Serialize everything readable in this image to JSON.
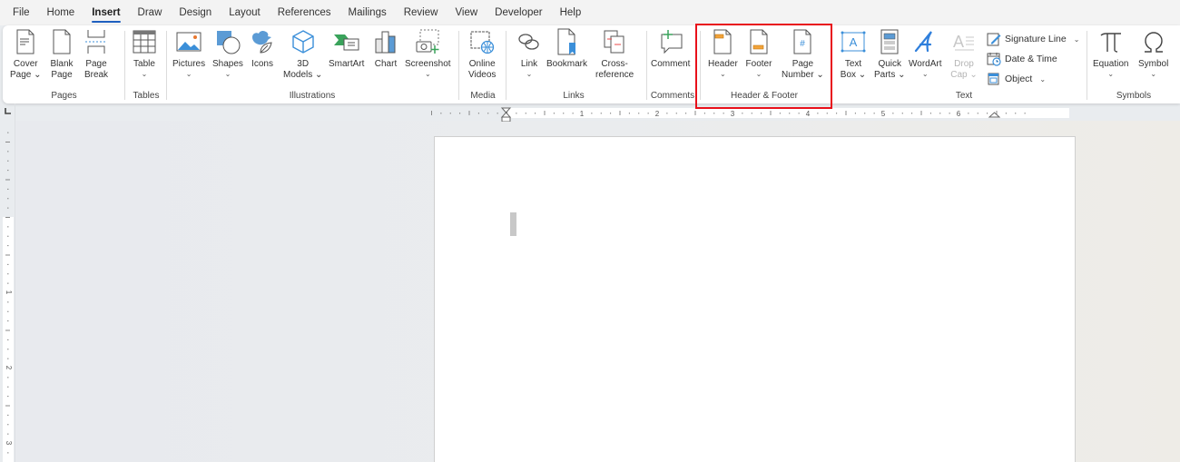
{
  "tabs": [
    "File",
    "Home",
    "Insert",
    "Draw",
    "Design",
    "Layout",
    "References",
    "Mailings",
    "Review",
    "View",
    "Developer",
    "Help"
  ],
  "active_tab": "Insert",
  "ribbon": {
    "groups": {
      "pages": {
        "label": "Pages",
        "cover_page": {
          "line1": "Cover",
          "line2": "Page ⌄"
        },
        "blank_page": {
          "line1": "Blank",
          "line2": "Page"
        },
        "page_break": {
          "line1": "Page",
          "line2": "Break"
        }
      },
      "tables": {
        "label": "Tables",
        "table": {
          "line1": "Table",
          "chev": "⌄"
        }
      },
      "illustrations": {
        "label": "Illustrations",
        "pictures": {
          "line1": "Pictures",
          "chev": "⌄"
        },
        "shapes": {
          "line1": "Shapes",
          "chev": "⌄"
        },
        "icons": {
          "line1": "Icons"
        },
        "models3d": {
          "line1": "3D",
          "line2": "Models ⌄"
        },
        "smartart": {
          "line1": "SmartArt"
        },
        "chart": {
          "line1": "Chart"
        },
        "screenshot": {
          "line1": "Screenshot",
          "chev": "⌄"
        }
      },
      "media": {
        "label": "Media",
        "online_videos": {
          "line1": "Online",
          "line2": "Videos"
        }
      },
      "links": {
        "label": "Links",
        "link": {
          "line1": "Link",
          "chev": "⌄"
        },
        "bookmark": {
          "line1": "Bookmark"
        },
        "cross_reference": {
          "line1": "Cross-",
          "line2": "reference"
        }
      },
      "comments": {
        "label": "Comments",
        "comment": {
          "line1": "Comment"
        }
      },
      "header_footer": {
        "label": "Header & Footer",
        "header": {
          "line1": "Header",
          "chev": "⌄"
        },
        "footer": {
          "line1": "Footer",
          "chev": "⌄"
        },
        "page_number": {
          "line1": "Page",
          "line2": "Number ⌄"
        }
      },
      "text": {
        "label": "Text",
        "text_box": {
          "line1": "Text",
          "line2": "Box ⌄"
        },
        "quick_parts": {
          "line1": "Quick",
          "line2": "Parts ⌄"
        },
        "wordart": {
          "line1": "WordArt",
          "chev": "⌄"
        },
        "drop_cap": {
          "line1": "Drop",
          "line2": "Cap ⌄",
          "disabled": true
        },
        "signature_line": "Signature Line",
        "date_time": "Date & Time",
        "object": "Object"
      },
      "symbols": {
        "label": "Symbols",
        "equation": {
          "line1": "Equation",
          "chev": "⌄"
        },
        "symbol": {
          "line1": "Symbol",
          "chev": "⌄"
        }
      }
    }
  },
  "ruler": {
    "horizontal_numbers": [
      "1",
      "2",
      "3",
      "4",
      "5",
      "6"
    ],
    "vertical_numbers": [
      "1",
      "2",
      "3"
    ]
  },
  "colors": {
    "accent": "#1e5fbf",
    "highlight": "#e8101a"
  }
}
